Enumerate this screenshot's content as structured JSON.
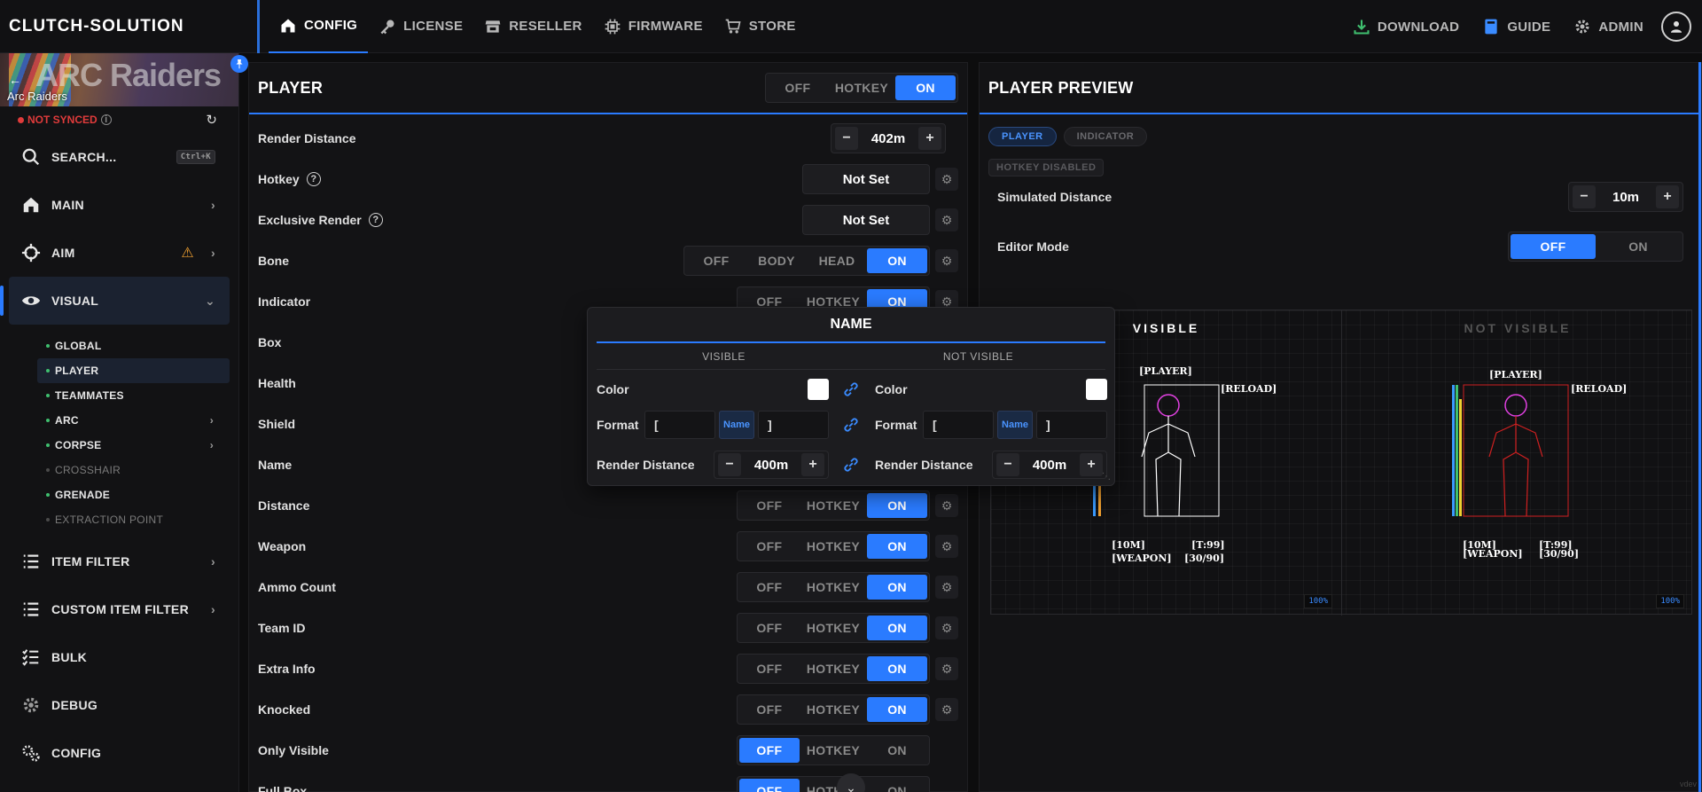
{
  "brand": "CLUTCH-SOLUTION",
  "nav": [
    {
      "label": "CONFIG",
      "icon": "home-icon",
      "active": true
    },
    {
      "label": "LICENSE",
      "icon": "key-icon"
    },
    {
      "label": "RESELLER",
      "icon": "store-icon"
    },
    {
      "label": "FIRMWARE",
      "icon": "chip-icon"
    },
    {
      "label": "STORE",
      "icon": "cart-icon"
    }
  ],
  "topright": {
    "download": "DOWNLOAD",
    "guide": "GUIDE",
    "admin": "ADMIN"
  },
  "sidebar": {
    "banner_title": "Arc Raiders",
    "banner_art": "ARC Raiders",
    "sync_status": "NOT SYNCED",
    "search_label": "SEARCH...",
    "search_shortcut": "Ctrl+K",
    "items": [
      {
        "label": "MAIN"
      },
      {
        "label": "AIM"
      },
      {
        "label": "VISUAL"
      }
    ],
    "subitems": [
      {
        "label": "GLOBAL"
      },
      {
        "label": "PLAYER"
      },
      {
        "label": "TEAMMATES"
      },
      {
        "label": "ARC"
      },
      {
        "label": "CORPSE"
      },
      {
        "label": "CROSSHAIR"
      },
      {
        "label": "GRENADE"
      },
      {
        "label": "EXTRACTION POINT"
      }
    ],
    "items2": [
      {
        "label": "ITEM FILTER"
      },
      {
        "label": "CUSTOM ITEM FILTER"
      },
      {
        "label": "BULK"
      },
      {
        "label": "DEBUG"
      },
      {
        "label": "CONFIG"
      }
    ]
  },
  "player": {
    "title": "PLAYER",
    "master": {
      "off": "OFF",
      "hotkey": "HOTKEY",
      "on": "ON"
    },
    "render_distance": {
      "label": "Render Distance",
      "value": "402m"
    },
    "hotkey": {
      "label": "Hotkey",
      "value": "Not Set"
    },
    "exclusive_render": {
      "label": "Exclusive Render",
      "value": "Not Set"
    },
    "bone": {
      "label": "Bone",
      "options": [
        "OFF",
        "BODY",
        "HEAD",
        "ON"
      ]
    },
    "rows": [
      {
        "label": "Indicator"
      },
      {
        "label": "Box"
      },
      {
        "label": "Health"
      },
      {
        "label": "Shield"
      },
      {
        "label": "Name"
      },
      {
        "label": "Distance"
      },
      {
        "label": "Weapon"
      },
      {
        "label": "Ammo Count"
      },
      {
        "label": "Team ID"
      },
      {
        "label": "Extra Info"
      },
      {
        "label": "Knocked"
      },
      {
        "label": "Only Visible"
      },
      {
        "label": "Full Box"
      }
    ],
    "seg": {
      "off": "OFF",
      "hotkey": "HOTKEY",
      "on": "ON"
    }
  },
  "popup": {
    "title": "NAME",
    "col_visible": "VISIBLE",
    "col_not_visible": "NOT VISIBLE",
    "color_label": "Color",
    "format_label": "Format",
    "format_prefix": "[",
    "format_tag": "Name",
    "format_suffix": "]",
    "render_label": "Render Distance",
    "render_value_l": "400m",
    "render_value_r": "400m"
  },
  "preview": {
    "title": "PLAYER PREVIEW",
    "tab_player": "PLAYER",
    "tab_indicator": "INDICATOR",
    "hotkey_disabled": "HOTKEY DISABLED",
    "sim_distance": {
      "label": "Simulated Distance",
      "value": "10m"
    },
    "editor_mode": {
      "label": "Editor Mode",
      "off": "OFF",
      "on": "ON"
    },
    "visible": "VISIBLE",
    "not_visible": "NOT VISIBLE",
    "esp": {
      "player": "[PLAYER]",
      "reload": "[RELOAD]",
      "dist": "[10M]",
      "team": "[T:99]",
      "weapon": "[WEAPON]",
      "ammo": "[30/90]"
    },
    "zoom": "100%",
    "watermark": "vdev"
  }
}
